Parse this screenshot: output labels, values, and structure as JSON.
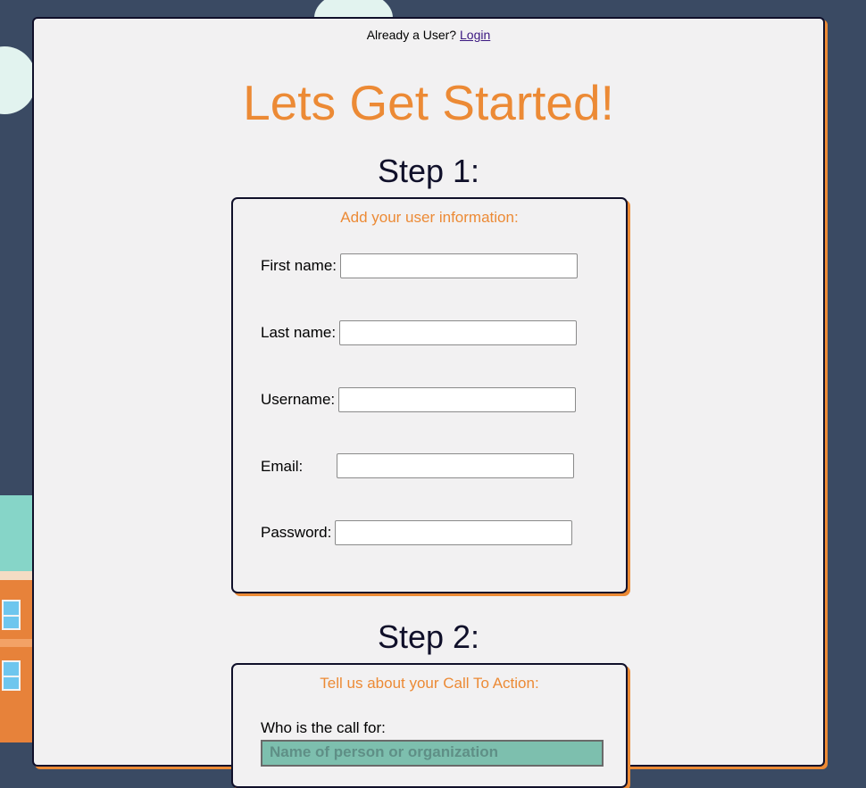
{
  "header": {
    "already_text": "Already a User?",
    "login_link": "Login"
  },
  "title": "Lets Get Started!",
  "step1": {
    "heading": "Step 1:",
    "subheading": "Add your user information:",
    "fields": [
      {
        "label": "First name:",
        "value": ""
      },
      {
        "label": "Last name:",
        "value": ""
      },
      {
        "label": "Username:",
        "value": ""
      },
      {
        "label": "Email:",
        "value": ""
      },
      {
        "label": "Password:",
        "value": ""
      }
    ]
  },
  "step2": {
    "heading": "Step 2:",
    "subheading": "Tell us about your Call To Action:",
    "who_label": "Who is the call for:",
    "who_select_value": "Name of person or organization"
  },
  "colors": {
    "accent": "#ec8a35",
    "dark": "#10102a",
    "background": "#3a4a63",
    "card": "#f2f1f2"
  }
}
